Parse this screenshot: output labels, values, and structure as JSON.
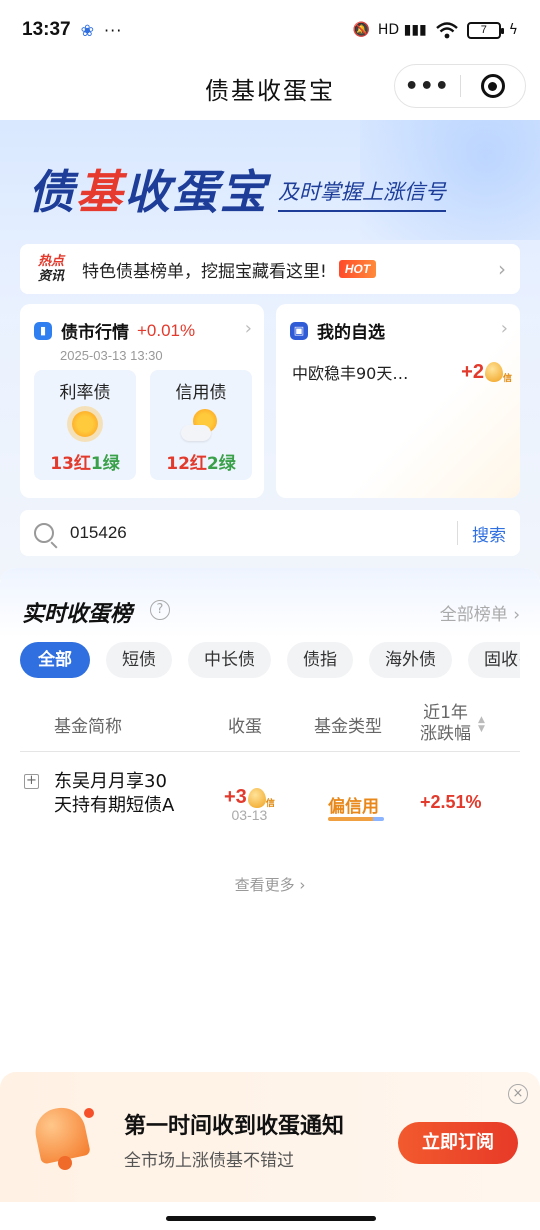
{
  "status": {
    "time": "13:37",
    "dots": "···",
    "signal": "HD ▮▮▮",
    "battery": "7"
  },
  "titlebar": {
    "title": "债基收蛋宝",
    "more": "•••"
  },
  "hero": {
    "logo_a": "债",
    "logo_b": "基",
    "logo_c": "收蛋宝",
    "slogan": "及时掌握上涨信号"
  },
  "news": {
    "tag_line1": "热点",
    "tag_line2": "资讯",
    "text": "特色债基榜单，挖掘宝藏看这里!",
    "hot": "HOT"
  },
  "market": {
    "title": "债市行情",
    "change": "+0.01%",
    "time": "2025-03-13 13:30",
    "rate": {
      "label": "利率债",
      "red": "13红",
      "green": "1绿"
    },
    "credit": {
      "label": "信用债",
      "red": "12红",
      "green": "2绿"
    }
  },
  "watchlist": {
    "title": "我的自选",
    "item_name": "中欧稳丰90天…",
    "item_value": "+2",
    "egg_label": "信"
  },
  "search": {
    "value": "015426",
    "button": "搜索"
  },
  "ranking": {
    "title": "实时收蛋榜",
    "help": "?",
    "all": "全部榜单 ›",
    "chips": [
      "全部",
      "短债",
      "中长债",
      "债指",
      "海外债",
      "固收+"
    ],
    "headers": {
      "name": "基金简称",
      "egg": "收蛋",
      "type": "基金类型",
      "change_1": "近1年",
      "change_2": "涨跌幅"
    },
    "rows": [
      {
        "name": "东吴月月享30天持有期短债A",
        "egg": "+3",
        "egg_label": "信",
        "date": "03-13",
        "type": "偏信用",
        "change": "+2.51%"
      }
    ],
    "more": "查看更多 ›"
  },
  "banner": {
    "title": "第一时间收到收蛋通知",
    "subtitle": "全市场上涨债基不错过",
    "button": "立即订阅",
    "close": "×"
  },
  "colors": {
    "accent": "#2f6fe0",
    "up_red": "#e23a2c",
    "down_green": "#3aa04a",
    "brand_navy": "#1d3d99"
  },
  "icons": [
    "wifi-icon",
    "battery-icon",
    "close-ring-icon",
    "search-icon",
    "bar-chart-icon",
    "bookmark-icon",
    "sun-icon",
    "cloud-sun-icon",
    "egg-icon",
    "bell-icon",
    "question-icon",
    "plus-box-icon",
    "sort-icon",
    "chevron-right-icon"
  ]
}
